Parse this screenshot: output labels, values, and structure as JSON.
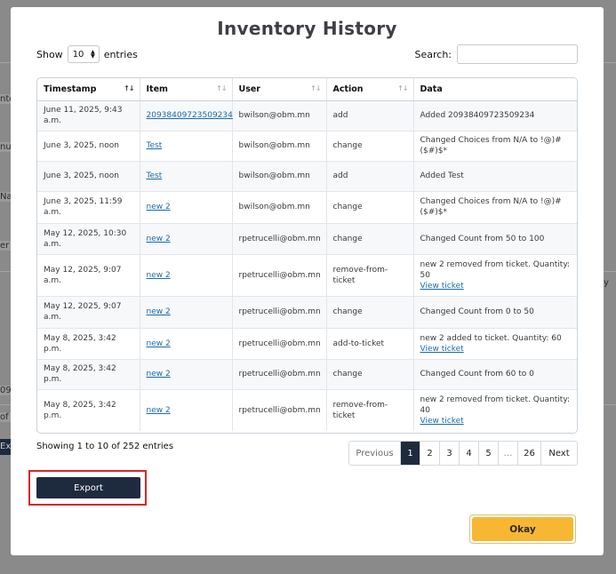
{
  "background": {
    "left_fragments": [
      "nto",
      "nu",
      "Na",
      "er",
      "09",
      "of",
      "Ex"
    ],
    "right_fragment": "y"
  },
  "modal": {
    "title": "Inventory History",
    "show_label": "Show",
    "page_length": "10",
    "entries_label": "entries",
    "search_label": "Search:",
    "search_value": ""
  },
  "table": {
    "columns": [
      "Timestamp",
      "Item",
      "User",
      "Action",
      "Data"
    ],
    "sort_icons": [
      "↑↓",
      "↑↓",
      "↑↓",
      "↑↓"
    ],
    "rows": [
      {
        "timestamp": "June 11, 2025, 9:43 a.m.",
        "item": "20938409723509234",
        "user": "bwilson@obm.mn",
        "action": "add",
        "data": "Added 20938409723509234",
        "link": ""
      },
      {
        "timestamp": "June 3, 2025, noon",
        "item": "Test",
        "user": "bwilson@obm.mn",
        "action": "change",
        "data": "Changed Choices from N/A to !@)#($#)$*",
        "link": ""
      },
      {
        "timestamp": "June 3, 2025, noon",
        "item": "Test",
        "user": "bwilson@obm.mn",
        "action": "add",
        "data": "Added Test",
        "link": ""
      },
      {
        "timestamp": "June 3, 2025, 11:59 a.m.",
        "item": "new 2",
        "user": "bwilson@obm.mn",
        "action": "change",
        "data": "Changed Choices from N/A to !@)#($#)$*",
        "link": ""
      },
      {
        "timestamp": "May 12, 2025, 10:30 a.m.",
        "item": "new 2",
        "user": "rpetrucelli@obm.mn",
        "action": "change",
        "data": "Changed Count from 50 to 100",
        "link": ""
      },
      {
        "timestamp": "May 12, 2025, 9:07 a.m.",
        "item": "new 2",
        "user": "rpetrucelli@obm.mn",
        "action": "remove-from-ticket",
        "data": "new 2 removed from ticket. Quantity: 50",
        "link": "View ticket"
      },
      {
        "timestamp": "May 12, 2025, 9:07 a.m.",
        "item": "new 2",
        "user": "rpetrucelli@obm.mn",
        "action": "change",
        "data": "Changed Count from 0 to 50",
        "link": ""
      },
      {
        "timestamp": "May 8, 2025, 3:42 p.m.",
        "item": "new 2",
        "user": "rpetrucelli@obm.mn",
        "action": "add-to-ticket",
        "data": "new 2 added to ticket. Quantity: 60",
        "link": "View ticket"
      },
      {
        "timestamp": "May 8, 2025, 3:42 p.m.",
        "item": "new 2",
        "user": "rpetrucelli@obm.mn",
        "action": "change",
        "data": "Changed Count from 60 to 0",
        "link": ""
      },
      {
        "timestamp": "May 8, 2025, 3:42 p.m.",
        "item": "new 2",
        "user": "rpetrucelli@obm.mn",
        "action": "remove-from-ticket",
        "data": "new 2 removed from ticket. Quantity: 40",
        "link": "View ticket"
      }
    ]
  },
  "info": "Showing 1 to 10 of 252 entries",
  "pagination": {
    "previous": "Previous",
    "pages": [
      "1",
      "2",
      "3",
      "4",
      "5",
      "…",
      "26"
    ],
    "current": "1",
    "next": "Next"
  },
  "export_label": "Export",
  "okay_label": "Okay",
  "colors": {
    "dark_button": "#1e2a3e",
    "okay_button": "#f7b733",
    "highlight": "#d9262b",
    "link": "#1a6aa8"
  }
}
